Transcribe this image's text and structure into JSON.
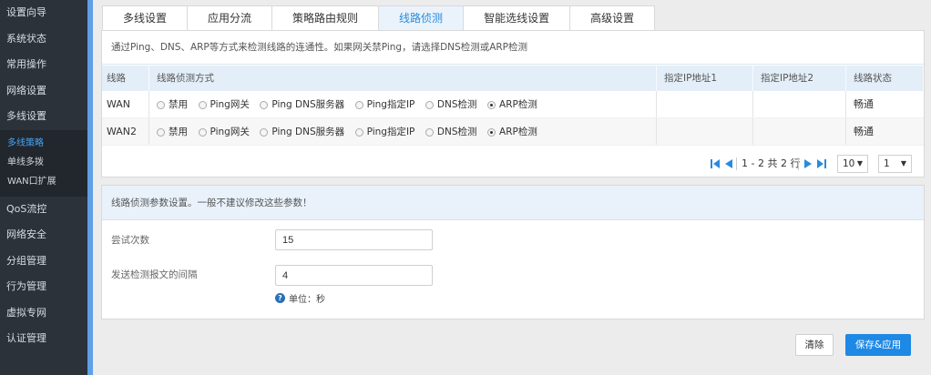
{
  "sidebar": {
    "items_top": [
      "设置向导",
      "系统状态",
      "常用操作",
      "网络设置",
      "多线设置"
    ],
    "sub_items": [
      "多线策略",
      "单线多拨",
      "WAN口扩展"
    ],
    "items_bottom": [
      "QoS流控",
      "网络安全",
      "分组管理",
      "行为管理",
      "虚拟专网",
      "认证管理"
    ]
  },
  "tabs": [
    "多线设置",
    "应用分流",
    "策略路由规则",
    "线路侦测",
    "智能选线设置",
    "高级设置"
  ],
  "panel1": {
    "notice": "通过Ping、DNS、ARP等方式来检测线路的连通性。如果网关禁Ping，请选择DNS检测或ARP检测",
    "headers": [
      "线路",
      "线路侦测方式",
      "指定IP地址1",
      "指定IP地址2",
      "线路状态"
    ],
    "radio_labels": [
      "禁用",
      "Ping网关",
      "Ping DNS服务器",
      "Ping指定IP",
      "DNS检测",
      "ARP检测"
    ],
    "rows": [
      {
        "line": "WAN",
        "status": "畅通"
      },
      {
        "line": "WAN2",
        "status": "畅通"
      }
    ],
    "pager_text": "1 - 2 共 2 行",
    "page_size": "10",
    "page_num": "1"
  },
  "panel2": {
    "notice": "线路侦测参数设置。一般不建议修改这些参数！",
    "retry_label": "尝试次数",
    "retry_value": "15",
    "interval_label": "发送检测报文的间隔",
    "interval_value": "4",
    "unit_text": "单位：秒"
  },
  "footer": {
    "clear_label": "清除",
    "save_label": "保存&应用"
  },
  "colors": {
    "sidebar_bg": "#2b323a",
    "accent": "#1e88e5",
    "tab_active": "#2a8adf",
    "sub_active": "#4aa3f0"
  }
}
